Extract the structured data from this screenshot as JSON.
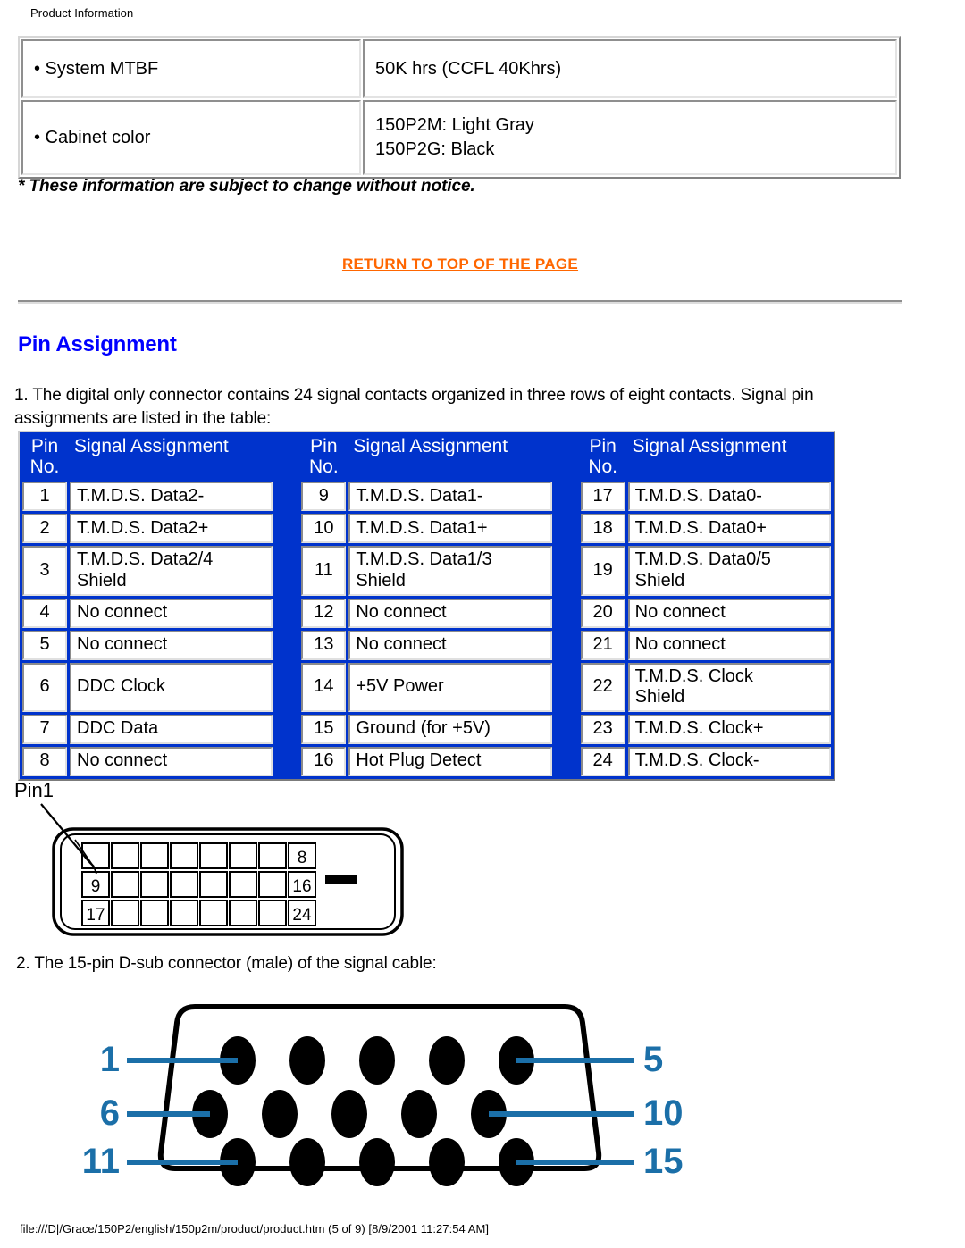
{
  "page_header": "Product Information",
  "spec_table": {
    "rows": [
      {
        "label": "• System MTBF",
        "value": "50K hrs (CCFL 40Khrs)"
      },
      {
        "label": "• Cabinet color",
        "value": "150P2M: Light Gray\n150P2G: Black"
      }
    ]
  },
  "notice": "* These information are subject to change without notice.",
  "return_link": "RETURN TO TOP OF THE PAGE",
  "section_heading": "Pin Assignment",
  "paragraph_1": "1. The digital only connector contains 24 signal contacts organized in three rows of eight contacts. Signal pin assignments are listed in the table:",
  "paragraph_2": "2. The 15-pin D-sub connector (male) of the signal cable:",
  "pin_table": {
    "headers": {
      "pin_no": "Pin\nNo.",
      "signal": "Signal Assignment"
    },
    "groups": [
      [
        {
          "pin": "1",
          "signal": "T.M.D.S. Data2-"
        },
        {
          "pin": "2",
          "signal": "T.M.D.S. Data2+"
        },
        {
          "pin": "3",
          "signal": "T.M.D.S. Data2/4 Shield"
        },
        {
          "pin": "4",
          "signal": "No connect"
        },
        {
          "pin": "5",
          "signal": "No connect"
        },
        {
          "pin": "6",
          "signal": "DDC Clock"
        },
        {
          "pin": "7",
          "signal": "DDC Data"
        },
        {
          "pin": "8",
          "signal": "No connect"
        }
      ],
      [
        {
          "pin": "9",
          "signal": "T.M.D.S. Data1-"
        },
        {
          "pin": "10",
          "signal": "T.M.D.S. Data1+"
        },
        {
          "pin": "11",
          "signal": "T.M.D.S. Data1/3 Shield"
        },
        {
          "pin": "12",
          "signal": "No connect"
        },
        {
          "pin": "13",
          "signal": "No connect"
        },
        {
          "pin": "14",
          "signal": "+5V Power"
        },
        {
          "pin": "15",
          "signal": "Ground (for +5V)"
        },
        {
          "pin": "16",
          "signal": "Hot Plug Detect"
        }
      ],
      [
        {
          "pin": "17",
          "signal": "T.M.D.S. Data0-"
        },
        {
          "pin": "18",
          "signal": "T.M.D.S. Data0+"
        },
        {
          "pin": "19",
          "signal": "T.M.D.S. Data0/5 Shield"
        },
        {
          "pin": "20",
          "signal": "No connect"
        },
        {
          "pin": "21",
          "signal": "No connect"
        },
        {
          "pin": "22",
          "signal": "T.M.D.S. Clock Shield"
        },
        {
          "pin": "23",
          "signal": "T.M.D.S. Clock+"
        },
        {
          "pin": "24",
          "signal": "T.M.D.S. Clock-"
        }
      ]
    ]
  },
  "dvi_figure": {
    "callout": "Pin1",
    "pin_labels": [
      "8",
      "9",
      "16",
      "17",
      "24"
    ]
  },
  "dsub_figure": {
    "labels_left": [
      "1",
      "6",
      "11"
    ],
    "labels_right": [
      "5",
      "10",
      "15"
    ],
    "label_color": "#1B6FA8"
  },
  "footer": "file:///D|/Grace/150P2/english/150p2m/product/product.htm (5 of 9) [8/9/2001 11:27:54 AM]",
  "colors": {
    "header_blue": "#0033CC",
    "heading_blue": "#0000FF",
    "link_orange": "#FF6600"
  }
}
